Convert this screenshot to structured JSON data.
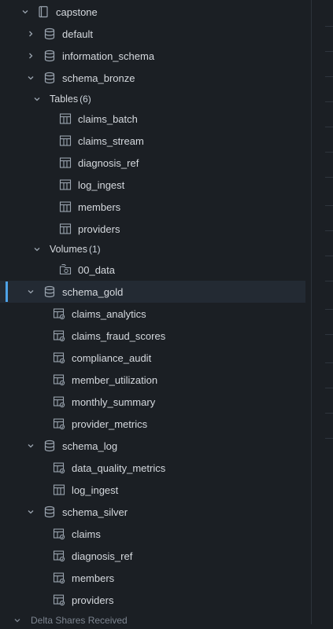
{
  "tree": {
    "catalog": {
      "label": "capstone",
      "icon": "catalog-icon"
    },
    "schemas": [
      {
        "label": "default",
        "icon": "database-icon",
        "expanded": false
      },
      {
        "label": "information_schema",
        "icon": "database-icon",
        "expanded": false
      },
      {
        "label": "schema_bronze",
        "icon": "database-icon",
        "expanded": true,
        "tables_group": {
          "label": "Tables",
          "count": "(6)"
        },
        "tables": [
          "claims_batch",
          "claims_stream",
          "diagnosis_ref",
          "log_ingest",
          "members",
          "providers"
        ],
        "volumes_group": {
          "label": "Volumes",
          "count": "(1)"
        },
        "volumes": [
          "00_data"
        ]
      },
      {
        "label": "schema_gold",
        "icon": "database-icon",
        "expanded": true,
        "selected": true,
        "items": [
          "claims_analytics",
          "claims_fraud_scores",
          "compliance_audit",
          "member_utilization",
          "monthly_summary",
          "provider_metrics"
        ]
      },
      {
        "label": "schema_log",
        "icon": "database-icon",
        "expanded": true,
        "items": [
          "data_quality_metrics",
          "log_ingest"
        ]
      },
      {
        "label": "schema_silver",
        "icon": "database-icon",
        "expanded": true,
        "items": [
          "claims",
          "diagnosis_ref",
          "members",
          "providers"
        ]
      }
    ],
    "footer": {
      "label": "Delta Shares Received"
    }
  },
  "colors": {
    "background": "#1b1f24",
    "selected_row": "#232a33",
    "accent": "#4ea3e8",
    "text": "#d5d9de",
    "icon": "#9aa4af"
  }
}
